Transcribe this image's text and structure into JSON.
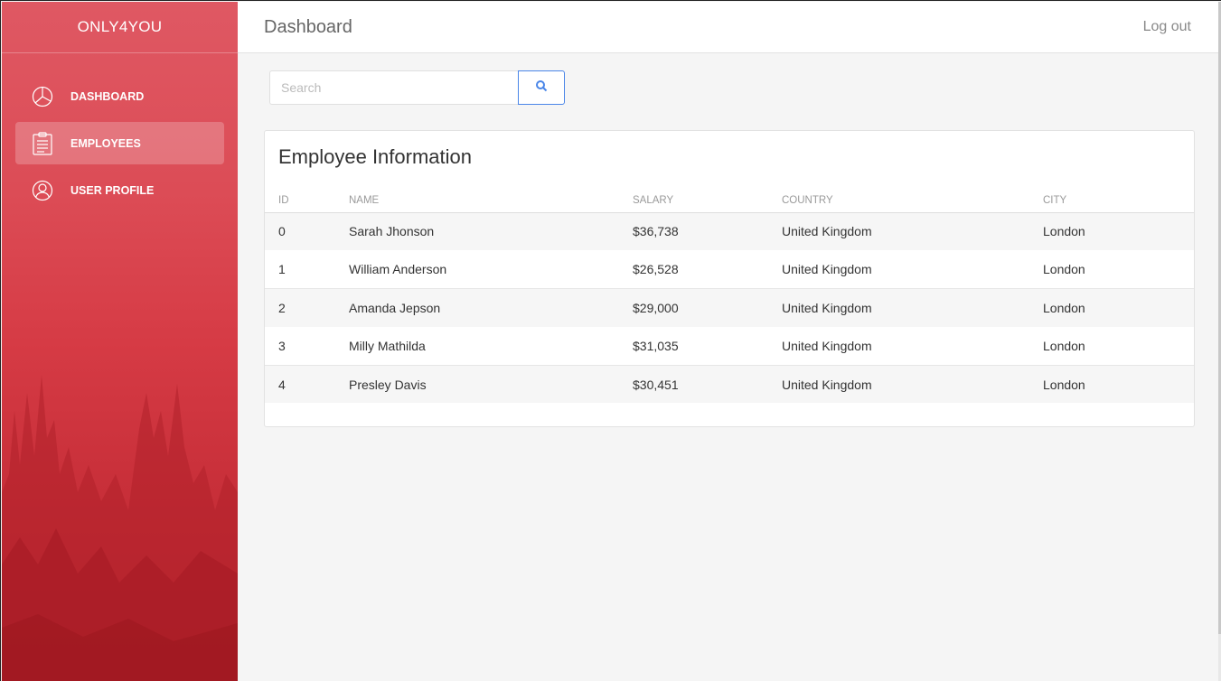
{
  "app": {
    "brand": "ONLY4YOU"
  },
  "sidebar": {
    "items": [
      {
        "label": "DASHBOARD",
        "icon": "pie-chart-icon",
        "active": false
      },
      {
        "label": "EMPLOYEES",
        "icon": "clipboard-icon",
        "active": true
      },
      {
        "label": "USER PROFILE",
        "icon": "user-icon",
        "active": false
      }
    ]
  },
  "header": {
    "title": "Dashboard",
    "logout": "Log out"
  },
  "search": {
    "placeholder": "Search",
    "value": "",
    "button_icon": "search-icon"
  },
  "table": {
    "title": "Employee Information",
    "columns": [
      "ID",
      "NAME",
      "SALARY",
      "COUNTRY",
      "CITY"
    ],
    "rows": [
      [
        "0",
        "Sarah Jhonson",
        "$36,738",
        "United Kingdom",
        "London"
      ],
      [
        "1",
        "William Anderson",
        "$26,528",
        "United Kingdom",
        "London"
      ],
      [
        "2",
        "Amanda Jepson",
        "$29,000",
        "United Kingdom",
        "London"
      ],
      [
        "3",
        "Milly Mathilda",
        "$31,035",
        "United Kingdom",
        "London"
      ],
      [
        "4",
        "Presley Davis",
        "$30,451",
        "United Kingdom",
        "London"
      ]
    ]
  },
  "colors": {
    "sidebar_top": "#df5863",
    "sidebar_bottom": "#b8232d",
    "search_button_border": "#4a86e8"
  }
}
